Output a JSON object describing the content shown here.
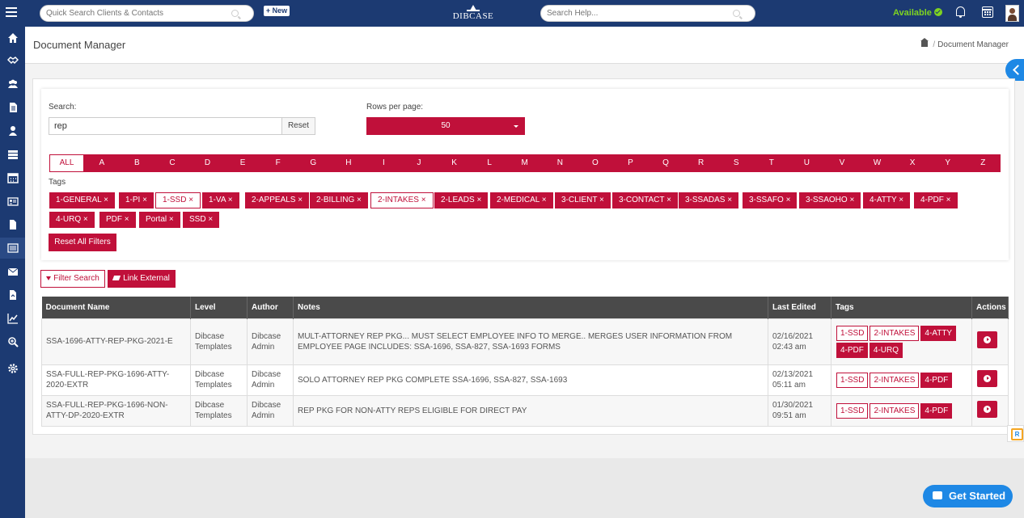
{
  "header": {
    "quick_search_placeholder": "Quick Search Clients & Contacts",
    "new_label": "+ New",
    "logo_text": "DIBCASE",
    "help_search_placeholder": "Search Help...",
    "status_label": "Available"
  },
  "sidebar": {
    "icons": [
      "home-icon",
      "handshake-icon",
      "users-icon",
      "document-icon",
      "user-icon",
      "server-icon",
      "calendar-icon",
      "id-card-icon",
      "file-icon",
      "list-icon",
      "envelope-icon",
      "file-export-icon",
      "chart-line-icon",
      "search-plus-icon",
      "gear-icon"
    ]
  },
  "page": {
    "title": "Document Manager",
    "breadcrumb_current": "Document Manager"
  },
  "filters": {
    "search_label": "Search:",
    "search_value": "rep",
    "reset_label": "Reset",
    "rows_label": "Rows per page:",
    "rows_value": "50",
    "tags_label": "Tags",
    "reset_all_label": "Reset All Filters",
    "alphabet": [
      "ALL",
      "A",
      "B",
      "C",
      "D",
      "E",
      "F",
      "G",
      "H",
      "I",
      "J",
      "K",
      "L",
      "M",
      "N",
      "O",
      "P",
      "Q",
      "R",
      "S",
      "T",
      "U",
      "V",
      "W",
      "X",
      "Y",
      "Z"
    ],
    "tags": [
      {
        "label": "1-GENERAL ×",
        "outline": false
      },
      {
        "label": "1-PI ×",
        "outline": false
      },
      {
        "label": "1-SSD ×",
        "outline": true
      },
      {
        "label": "1-VA ×",
        "outline": false
      },
      {
        "label": "2-APPEALS ×",
        "outline": false
      },
      {
        "label": "2-BILLING ×",
        "outline": false
      },
      {
        "label": "2-INTAKES ×",
        "outline": true
      },
      {
        "label": "2-LEADS ×",
        "outline": false
      },
      {
        "label": "2-MEDICAL ×",
        "outline": false
      },
      {
        "label": "3-CLIENT ×",
        "outline": false
      },
      {
        "label": "3-CONTACT ×",
        "outline": false
      },
      {
        "label": "3-SSADAS ×",
        "outline": false
      },
      {
        "label": "3-SSAFO ×",
        "outline": false
      },
      {
        "label": "3-SSAOHO ×",
        "outline": false
      },
      {
        "label": "4-ATTY ×",
        "outline": false
      },
      {
        "label": "4-PDF ×",
        "outline": false
      },
      {
        "label": "4-URQ ×",
        "outline": false
      },
      {
        "label": "PDF ×",
        "outline": false
      },
      {
        "label": "Portal ×",
        "outline": false
      },
      {
        "label": "SSD ×",
        "outline": false
      }
    ]
  },
  "actions": {
    "filter_search_label": "Filter Search",
    "link_external_label": "Link External"
  },
  "table": {
    "columns": [
      "Document Name",
      "Level",
      "Author",
      "Notes",
      "Last Edited",
      "Tags",
      "Actions"
    ],
    "rows": [
      {
        "name": "SSA-1696-ATTY-REP-PKG-2021-E",
        "level": "Dibcase Templates",
        "author": "Dibcase Admin",
        "notes": "MULT-ATTORNEY REP PKG... MUST SELECT EMPLOYEE INFO TO MERGE.. MERGES USER INFORMATION FROM EMPLOYEE PAGE INCLUDES: SSA-1696, SSA-827, SSA-1693 FORMS",
        "date": "02/16/2021",
        "time": "02:43 am",
        "tags": [
          {
            "label": "1-SSD",
            "fill": false
          },
          {
            "label": "2-INTAKES",
            "fill": false
          },
          {
            "label": "4-ATTY",
            "fill": true
          },
          {
            "label": "4-PDF",
            "fill": true
          },
          {
            "label": "4-URQ",
            "fill": true
          }
        ]
      },
      {
        "name": "SSA-FULL-REP-PKG-1696-ATTY-2020-EXTR",
        "level": "Dibcase Templates",
        "author": "Dibcase Admin",
        "notes": "SOLO ATTORNEY REP PKG COMPLETE SSA-1696, SSA-827, SSA-1693",
        "date": "02/13/2021",
        "time": "05:11 am",
        "tags": [
          {
            "label": "1-SSD",
            "fill": false
          },
          {
            "label": "2-INTAKES",
            "fill": false
          },
          {
            "label": "4-PDF",
            "fill": true
          }
        ]
      },
      {
        "name": "SSA-FULL-REP-PKG-1696-NON-ATTY-DP-2020-EXTR",
        "level": "Dibcase Templates",
        "author": "Dibcase Admin",
        "notes": "REP PKG FOR NON-ATTY REPS ELIGIBLE FOR DIRECT PAY",
        "date": "01/30/2021",
        "time": "09:51 am",
        "tags": [
          {
            "label": "1-SSD",
            "fill": false
          },
          {
            "label": "2-INTAKES",
            "fill": false
          },
          {
            "label": "4-PDF",
            "fill": true
          }
        ]
      }
    ]
  },
  "widgets": {
    "get_started_label": "Get Started"
  }
}
